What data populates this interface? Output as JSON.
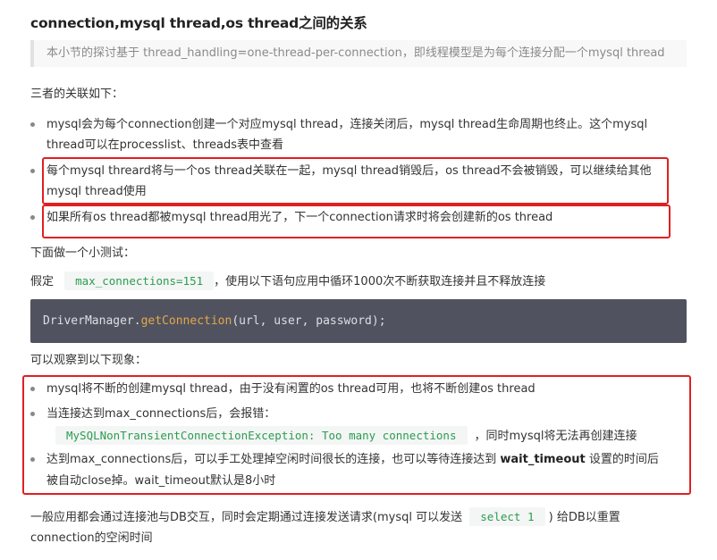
{
  "title": "connection,mysql thread,os thread之间的关系",
  "quote": "本小节的探讨基于 thread_handling=one-thread-per-connection，即线程模型是为每个连接分配一个mysql thread",
  "relation_heading": "三者的关联如下：",
  "relation_items": [
    {
      "line1": "mysql会为每个connection创建一个对应mysql thread，连接关闭后，mysql thread生命周期也终止。这个mysql",
      "line2": "thread可以在processlist、threads表中查看"
    },
    {
      "line1": "每个mysql threard将与一个os thread关联在一起，mysql thread销毁后，os thread不会被销毁，可以继续给其他",
      "line2": "mysql thread使用"
    },
    {
      "line1": "如果所有os thread都被mysql thread用光了，下一个connection请求时将会创建新的os thread"
    }
  ],
  "test_heading": "下面做一个小测试：",
  "test_line": {
    "prefix": "假定",
    "code": "max_connections=151",
    "suffix": "，使用以下语句应用中循环1000次不断获取连接并且不释放连接"
  },
  "codeblock": {
    "obj": "DriverManager.",
    "fn": "getConnection",
    "args": "(url, user, password);"
  },
  "observe_heading": "可以观察到以下现象：",
  "observe_items": {
    "item1": "mysql将不断的创建mysql thread，由于没有闲置的os thread可用，也将不断创建os  thread",
    "item2_line1": "当连接达到max_connections后，会报错：",
    "item2_code": "MySQLNonTransientConnectionException: Too many connections",
    "item2_suffix": "，同时mysql将无法再创建连接",
    "item3_prefix": "达到max_connections后，可以手工处理掉空闲时间很长的连接，也可以等待连接达到",
    "item3_bold": "wait_timeout",
    "item3_suffix": "设置的时间后",
    "item3_line2": "被自动close掉。wait_timeout默认是8小时"
  },
  "footer": {
    "prefix": "一般应用都会通过连接池与DB交互，同时会定期通过连接发送请求(mysql 可以发送",
    "code": "select 1",
    "suffix": ") 给DB以重置",
    "line2": "connection的空闲时间"
  },
  "colors": {
    "highlight_border": "#e02020",
    "code_green": "#2a9d4f",
    "codeblock_bg": "#50535f",
    "function_color": "#e5a64b"
  }
}
